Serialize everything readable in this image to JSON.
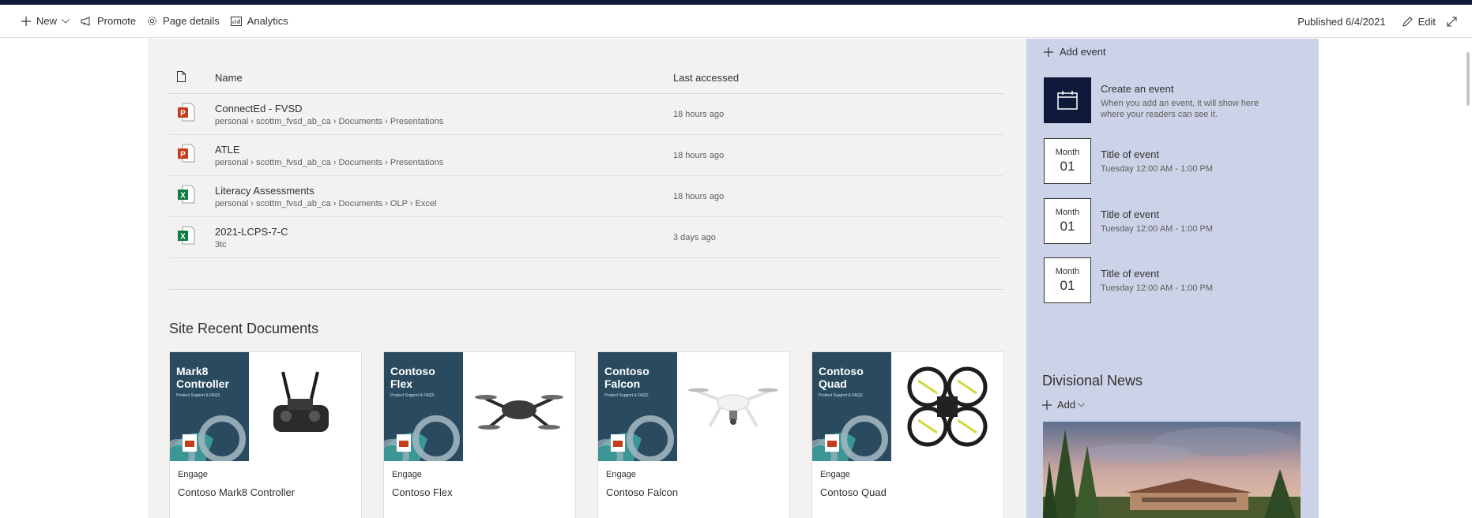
{
  "commandbar": {
    "new_label": "New",
    "promote_label": "Promote",
    "page_details_label": "Page details",
    "analytics_label": "Analytics",
    "published_label": "Published 6/4/2021",
    "edit_label": "Edit"
  },
  "recent_files": {
    "col_name": "Name",
    "col_last_accessed": "Last accessed",
    "rows": [
      {
        "name": "ConnectEd - FVSD",
        "path": "personal › scottm_fvsd_ab_ca › Documents › Presentations",
        "accessed": "18 hours ago",
        "type": "powerpoint-icon"
      },
      {
        "name": "ATLE",
        "path": "personal › scottm_fvsd_ab_ca › Documents › Presentations",
        "accessed": "18 hours ago",
        "type": "powerpoint-icon"
      },
      {
        "name": "Literacy Assessments",
        "path": "personal › scottm_fvsd_ab_ca › Documents › OLP › Excel",
        "accessed": "18 hours ago",
        "type": "excel-icon"
      },
      {
        "name": "2021-LCPS-7-C",
        "path": "3tc",
        "accessed": "3 days ago",
        "type": "excel-icon"
      }
    ]
  },
  "site_recent": {
    "title": "Site Recent Documents",
    "cards": [
      {
        "thumb_title": "Mark8\nController",
        "thumb_sub": "Product Support & FAQS",
        "category": "Engage",
        "title": "Contoso Mark8 Controller"
      },
      {
        "thumb_title": "Contoso\nFlex",
        "thumb_sub": "Product Support & FAQS",
        "category": "Engage",
        "title": "Contoso Flex"
      },
      {
        "thumb_title": "Contoso\nFalcon",
        "thumb_sub": "Product Support & FAQS",
        "category": "Engage",
        "title": "Contoso Falcon"
      },
      {
        "thumb_title": "Contoso\nQuad",
        "thumb_sub": "Product Support & FAQS",
        "category": "Engage",
        "title": "Contoso Quad"
      }
    ]
  },
  "events": {
    "add_label": "Add event",
    "create": {
      "title": "Create an event",
      "desc": "When you add an event, it will show here where your readers can see it."
    },
    "items": [
      {
        "month": "Month",
        "day": "01",
        "title": "Title of event",
        "time": "Tuesday 12:00 AM - 1:00 PM"
      },
      {
        "month": "Month",
        "day": "01",
        "title": "Title of event",
        "time": "Tuesday 12:00 AM - 1:00 PM"
      },
      {
        "month": "Month",
        "day": "01",
        "title": "Title of event",
        "time": "Tuesday 12:00 AM - 1:00 PM"
      }
    ]
  },
  "news": {
    "title": "Divisional News",
    "add_label": "Add"
  },
  "colors": {
    "topbar": "#0f1a3a",
    "side_panel": "#ccd3e8",
    "main_bg": "#f3f2f1",
    "thumb_bg": "#2a4a5f",
    "ppt": "#c43e1c",
    "excel": "#107c41"
  }
}
